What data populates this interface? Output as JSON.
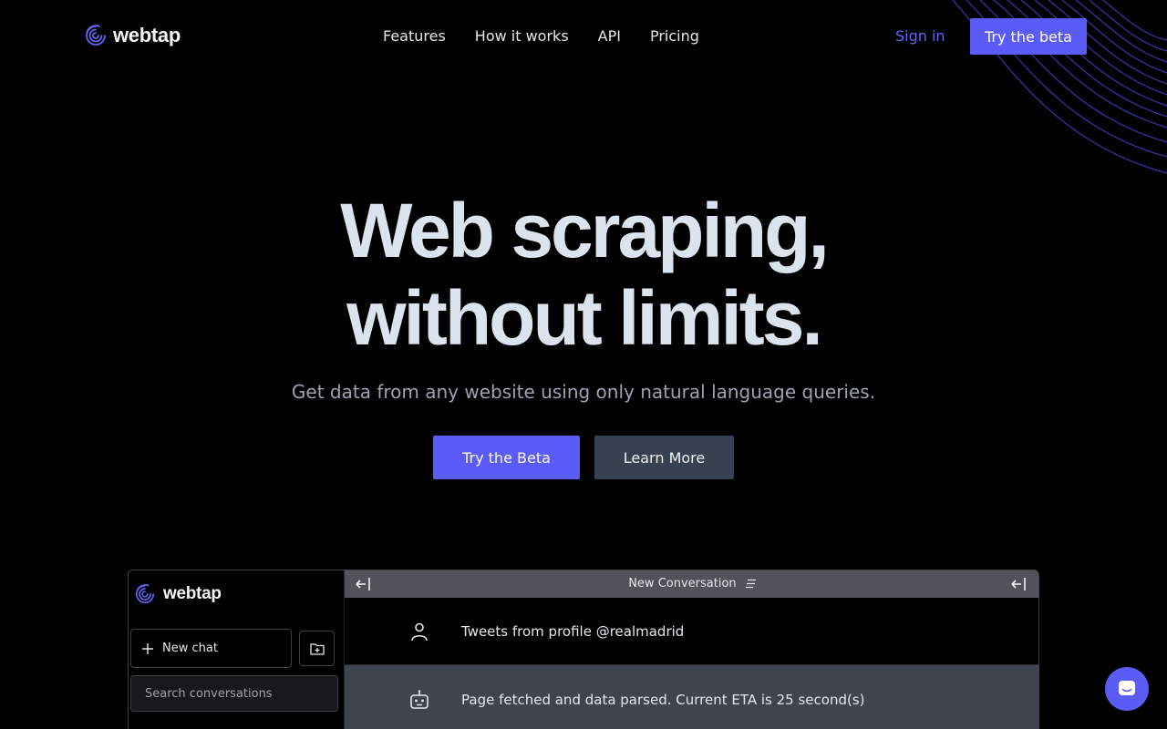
{
  "brand": {
    "name": "webtap",
    "accent": "#5b5bf7"
  },
  "nav": {
    "links": [
      "Features",
      "How it works",
      "API",
      "Pricing"
    ],
    "signin": "Sign in",
    "cta": "Try the beta"
  },
  "hero": {
    "title_line1": "Web scraping,",
    "title_line2": "without limits.",
    "subtitle": "Get data from any website using only natural language queries.",
    "primary_cta": "Try the Beta",
    "secondary_cta": "Learn More"
  },
  "app": {
    "brand": "webtap",
    "new_chat": "New chat",
    "search_placeholder": "Search conversations",
    "conversation_title": "New Conversation",
    "messages": [
      {
        "role": "user",
        "icon": "user-icon",
        "text": "Tweets from profile @realmadrid"
      },
      {
        "role": "bot",
        "icon": "bot-icon",
        "text": "Page fetched and data parsed. Current ETA is 25 second(s)"
      }
    ]
  },
  "help": {
    "icon": "chat-bubble-icon"
  }
}
